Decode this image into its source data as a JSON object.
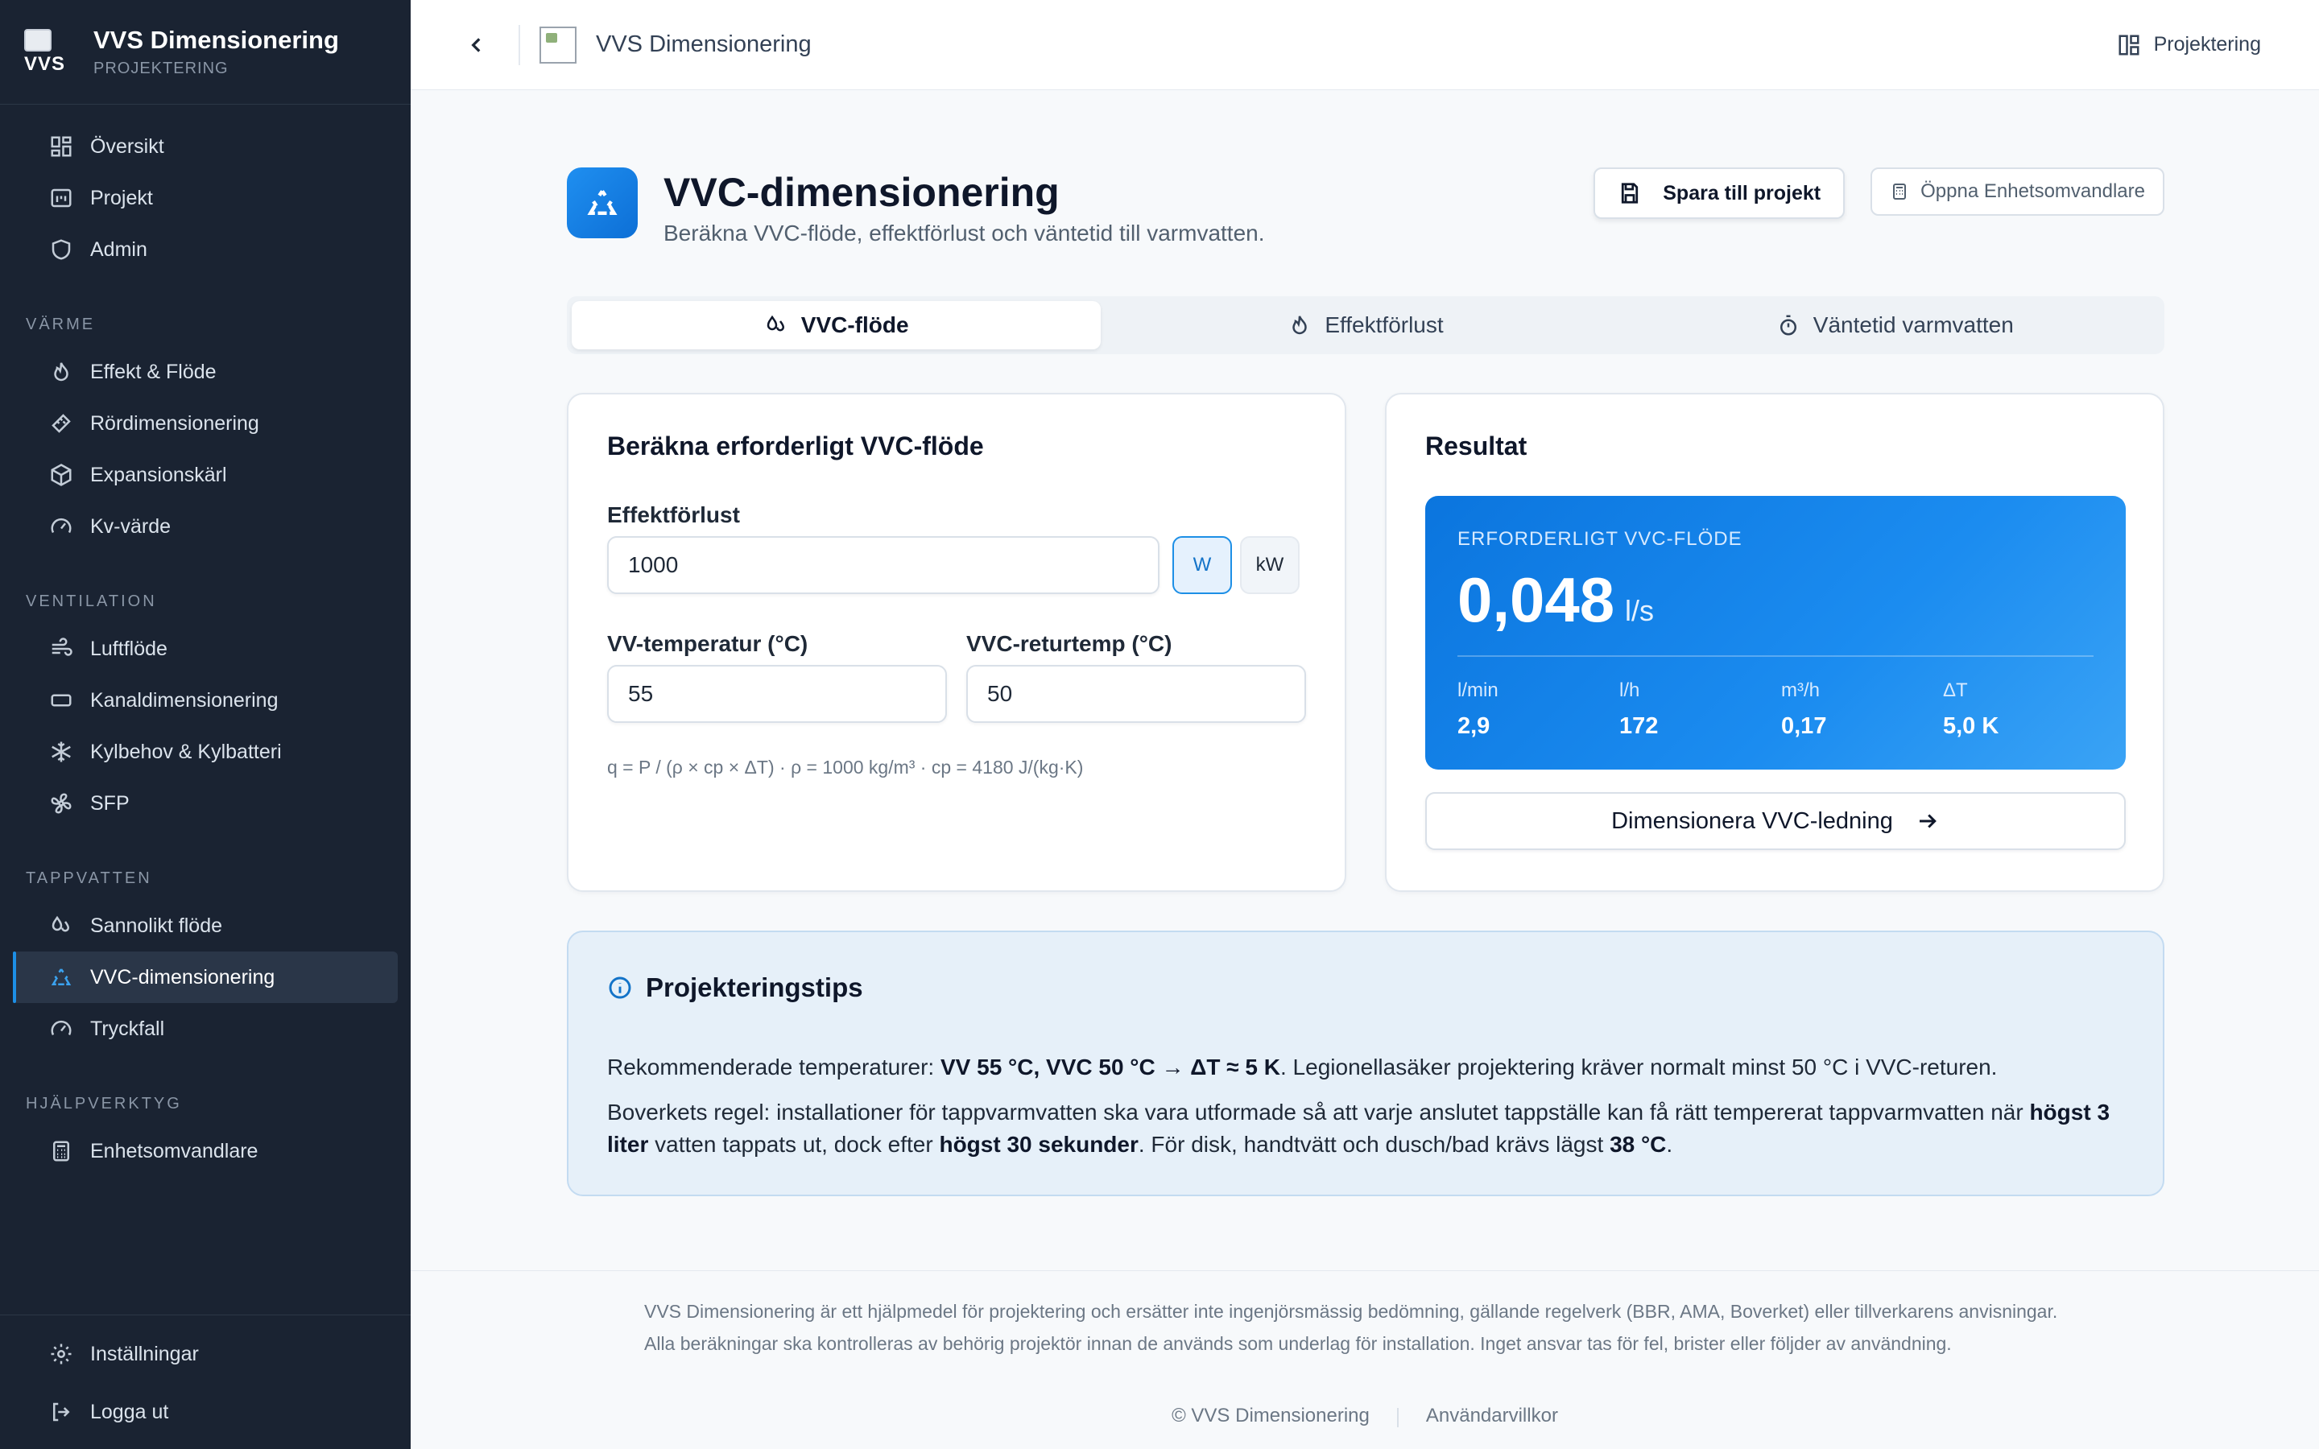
{
  "app": {
    "title": "VVS Dimensionering",
    "subtitle": "PROJEKTERING",
    "logo_text": "VVS"
  },
  "sidebar": {
    "top_items": [
      {
        "label": "Översikt",
        "icon": "dashboard-icon"
      },
      {
        "label": "Projekt",
        "icon": "project-icon"
      },
      {
        "label": "Admin",
        "icon": "shield-icon"
      }
    ],
    "sections": [
      {
        "title": "VÄRME",
        "items": [
          {
            "label": "Effekt & Flöde",
            "icon": "flame-icon"
          },
          {
            "label": "Rördimensionering",
            "icon": "ruler-icon"
          },
          {
            "label": "Expansionskärl",
            "icon": "box-icon"
          },
          {
            "label": "Kv-värde",
            "icon": "gauge-icon"
          }
        ]
      },
      {
        "title": "VENTILATION",
        "items": [
          {
            "label": "Luftflöde",
            "icon": "wind-icon"
          },
          {
            "label": "Kanaldimensionering",
            "icon": "duct-icon"
          },
          {
            "label": "Kylbehov & Kylbatteri",
            "icon": "snowflake-icon"
          },
          {
            "label": "SFP",
            "icon": "fan-icon"
          }
        ]
      },
      {
        "title": "TAPPVATTEN",
        "items": [
          {
            "label": "Sannolikt flöde",
            "icon": "droplets-icon"
          },
          {
            "label": "VVC-dimensionering",
            "icon": "recycle-icon",
            "active": true
          },
          {
            "label": "Tryckfall",
            "icon": "gauge-icon"
          }
        ]
      },
      {
        "title": "HJÄLPVERKTYG",
        "items": [
          {
            "label": "Enhetsomvandlare",
            "icon": "calculator-icon"
          }
        ]
      }
    ],
    "bottom_items": [
      {
        "label": "Inställningar",
        "icon": "gear-icon"
      },
      {
        "label": "Logga ut",
        "icon": "logout-icon"
      }
    ]
  },
  "topbar": {
    "title": "VVS Dimensionering",
    "right_label": "Projektering"
  },
  "page": {
    "title": "VVC-dimensionering",
    "subtitle": "Beräkna VVC-flöde, effektförlust och väntetid till varmvatten.",
    "save_label": "Spara till projekt",
    "converter_label": "Öppna Enhetsomvandlare"
  },
  "tabs": [
    {
      "label": "VVC-flöde",
      "active": true
    },
    {
      "label": "Effektförlust",
      "active": false
    },
    {
      "label": "Väntetid varmvatten",
      "active": false
    }
  ],
  "calc": {
    "title": "Beräkna erforderligt VVC-flöde",
    "effekt_label": "Effektförlust",
    "effekt_value": "1000",
    "unit_w": "W",
    "unit_kw": "kW",
    "selected_unit": "W",
    "vv_label": "VV-temperatur (°C)",
    "vv_value": "55",
    "vvc_label": "VVC-returtemp (°C)",
    "vvc_value": "50",
    "formula": "q = P / (ρ × cp × ΔT) · ρ = 1000 kg/m³ · cp = 4180 J/(kg·K)"
  },
  "result": {
    "title": "Resultat",
    "label": "ERFORDERLIGT VVC-FLÖDE",
    "value": "0,048",
    "unit": "l/s",
    "stats": [
      {
        "k": "l/min",
        "v": "2,9"
      },
      {
        "k": "l/h",
        "v": "172"
      },
      {
        "k": "m³/h",
        "v": "0,17"
      },
      {
        "k": "ΔT",
        "v": "5,0 K"
      }
    ],
    "button_label": "Dimensionera VVC-ledning"
  },
  "tips": {
    "title": "Projekteringstips",
    "p1_a": "Rekommenderade temperaturer: ",
    "p1_b": "VV 55 °C, VVC 50 °C → ΔT ≈ 5 K",
    "p1_c": ". Legionellasäker projektering kräver normalt minst 50 °C i VVC-returen.",
    "p2_a": "Boverkets regel: installationer för tappvarmvatten ska vara utformade så att varje anslutet tappställe kan få rätt tempererat tappvarmvatten när ",
    "p2_b": "högst 3 liter",
    "p2_c": " vatten tappats ut, dock efter ",
    "p2_d": "högst 30 sekunder",
    "p2_e": ". För disk, handtvätt och dusch/bad krävs lägst ",
    "p2_f": "38 °C",
    "p2_g": "."
  },
  "footer": {
    "disclaimer": "VVS Dimensionering är ett hjälpmedel för projektering och ersätter inte ingenjörsmässig bedömning, gällande regelverk (BBR, AMA, Boverket) eller tillverkarens anvisningar. Alla beräkningar ska kontrolleras av behörig projektör innan de används som underlag för installation. Inget ansvar tas för fel, brister eller följder av användning.",
    "copyright": "© VVS Dimensionering",
    "terms": "Användarvillkor"
  },
  "colors": {
    "accent": "#1d8fe6",
    "sidebar_bg": "#1a2332",
    "result_bg": "#0b75de"
  }
}
